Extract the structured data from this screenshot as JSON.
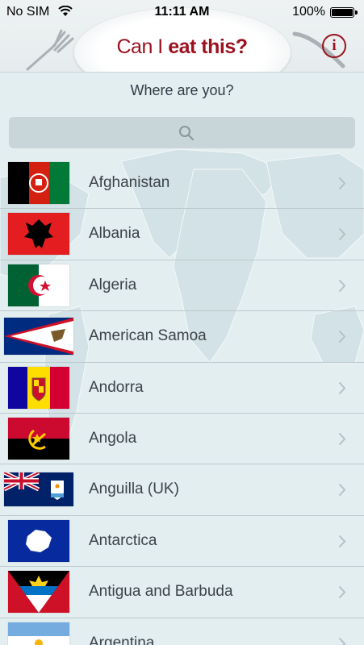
{
  "status_bar": {
    "carrier": "No SIM",
    "time": "11:11 AM",
    "battery": "100%"
  },
  "header": {
    "logo_light": "Can I ",
    "logo_bold": "eat this?",
    "info_label": "i"
  },
  "prompt": "Where are you?",
  "search": {
    "placeholder": "",
    "value": ""
  },
  "icons": {
    "search": "search-icon",
    "row_disclosure": "chevron-right-icon",
    "info": "info-icon"
  },
  "colors": {
    "brand": "#9b111e",
    "background": "#e3eef0",
    "search_field": "#c8d5d9",
    "separator": "#bcc9cd"
  },
  "countries": [
    {
      "name": "Afghanistan",
      "flag": "afghanistan-flag"
    },
    {
      "name": "Albania",
      "flag": "albania-flag"
    },
    {
      "name": "Algeria",
      "flag": "algeria-flag"
    },
    {
      "name": "American Samoa",
      "flag": "american-samoa-flag"
    },
    {
      "name": "Andorra",
      "flag": "andorra-flag"
    },
    {
      "name": "Angola",
      "flag": "angola-flag"
    },
    {
      "name": "Anguilla (UK)",
      "flag": "anguilla-flag"
    },
    {
      "name": "Antarctica",
      "flag": "antarctica-flag"
    },
    {
      "name": "Antigua and Barbuda",
      "flag": "antigua-and-barbuda-flag"
    },
    {
      "name": "Argentina",
      "flag": "argentina-flag"
    }
  ]
}
